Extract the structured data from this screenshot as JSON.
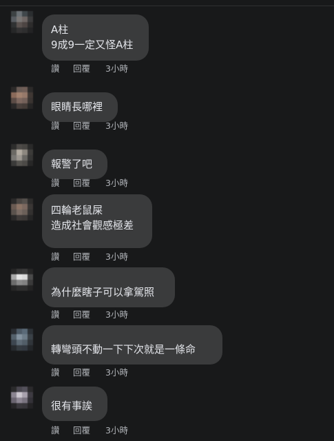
{
  "comments": [
    {
      "lines": [
        "A柱",
        "9成9一定又怪A柱"
      ],
      "like": "讚",
      "reply": "回覆",
      "time": "3小時",
      "avatar": [
        "#3d4244",
        "#6b7176",
        "#40474b",
        "#2b2e30",
        "#585c61",
        "#7a7776",
        "#6f6765",
        "#3a3a3b",
        "#303233",
        "#5b5350",
        "#4d4543",
        "#2d2c2c",
        "#262728",
        "#333233",
        "#2e2e2f",
        "#232324"
      ]
    },
    {
      "lines": [
        "眼睛長哪裡"
      ],
      "like": "讚",
      "reply": "回覆",
      "time": "3小時",
      "avatar": [
        "#2c2a29",
        "#6a5c56",
        "#705e57",
        "#2c2a29",
        "#8a6a5a",
        "#a2826f",
        "#96796a",
        "#403834",
        "#5c4c46",
        "#7e6860",
        "#74615a",
        "#3a3431",
        "#2a2828",
        "#4a403c",
        "#443b37",
        "#262525"
      ]
    },
    {
      "lines": [
        "報警了吧"
      ],
      "like": "讚",
      "reply": "回覆",
      "time": "3小時",
      "avatar": [
        "#2d2d2c",
        "#4e4b48",
        "#474542",
        "#2a2a2a",
        "#6b6964",
        "#b3aca2",
        "#8d8880",
        "#3c3b39",
        "#7a7874",
        "#9d9891",
        "#6a6864",
        "#353534",
        "#3a3a39",
        "#55534f",
        "#4c4a47",
        "#272727"
      ]
    },
    {
      "lines": [
        "四輪老鼠屎",
        "造成社會觀感極差"
      ],
      "like": "讚",
      "reply": "回覆",
      "time": "3小時",
      "avatar": [
        "#2b2a2a",
        "#4a4542",
        "#55504c",
        "#2d2c2b",
        "#6a5a52",
        "#8c7466",
        "#7c6960",
        "#3a3735",
        "#5a524d",
        "#7a6c64",
        "#6b6059",
        "#333130",
        "#2a2929",
        "#3f3b39",
        "#3b3836",
        "#252525"
      ]
    },
    {
      "lines": [
        "為什麼瞎子可以拿駕照"
      ],
      "like": "讚",
      "reply": "回覆",
      "time": "3小時",
      "avatar": [
        "#262626",
        "#363636",
        "#3a3a3a",
        "#262626",
        "#a9a9a9",
        "#e6e6e6",
        "#dcdcdc",
        "#4a4a4a",
        "#6c6c6c",
        "#8a8a8a",
        "#828282",
        "#3a3a3a",
        "#262626",
        "#2e2e2e",
        "#2e2e2e",
        "#232323"
      ]
    },
    {
      "lines": [
        "轉彎頭不動一下下次就是一條命"
      ],
      "like": "讚",
      "reply": "回覆",
      "time": "3小時",
      "avatar": [
        "#2a2e33",
        "#4d5a66",
        "#5a6a78",
        "#2c3136",
        "#54616c",
        "#8493a0",
        "#6e7d89",
        "#3a4147",
        "#3d4650",
        "#5e6b76",
        "#525e68",
        "#30353a",
        "#262a2e",
        "#353b41",
        "#323840",
        "#232629"
      ]
    },
    {
      "lines": [
        "很有事誒"
      ],
      "like": "讚",
      "reply": "回覆",
      "time": "3小時",
      "avatar": [
        "#2a2a2b",
        "#4a4750",
        "#55525c",
        "#2b2a2c",
        "#8a8490",
        "#cdc8d0",
        "#a9a2ae",
        "#3e3b42",
        "#6a6470",
        "#8e8794",
        "#7a7480",
        "#343238",
        "#262527",
        "#3a383d",
        "#37353a",
        "#232224"
      ]
    }
  ]
}
